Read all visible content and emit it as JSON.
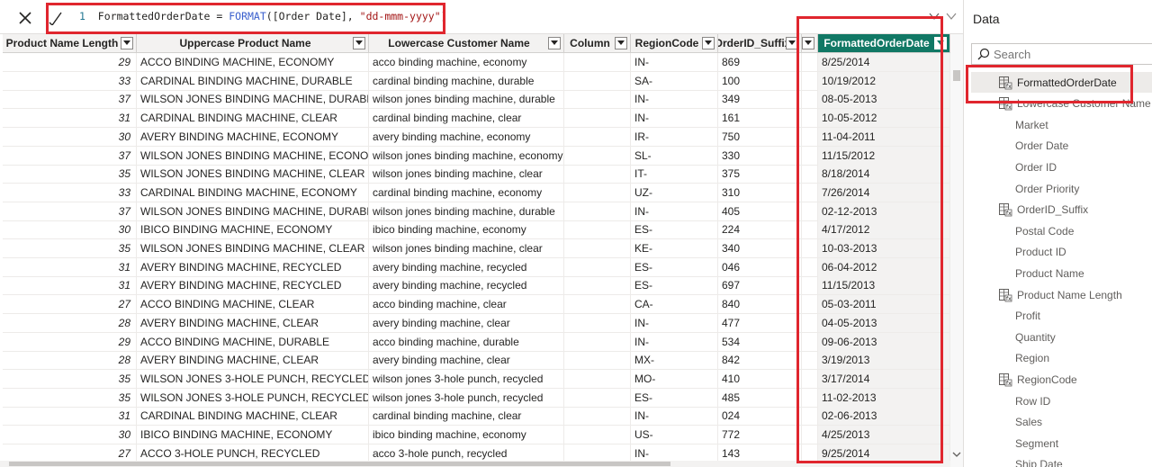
{
  "formula": {
    "line_number": "1",
    "measure_name": "FormattedOrderDate",
    "operator": "=",
    "function": "FORMAT",
    "args_open": "([Order Date], ",
    "format_string": "\"dd-mmm-yyyy\"",
    "args_close": ")"
  },
  "table": {
    "columns": [
      {
        "label": "Product Name Length"
      },
      {
        "label": "Uppercase Product Name"
      },
      {
        "label": "Lowercase Customer Name"
      },
      {
        "label": "Column"
      },
      {
        "label": "RegionCode"
      },
      {
        "label": "OrderID_Suffix"
      },
      {
        "label": ""
      },
      {
        "label": "FormattedOrderDate"
      }
    ],
    "rows": [
      [
        "29",
        "ACCO BINDING MACHINE, ECONOMY",
        "acco binding machine, economy",
        "",
        "IN-",
        "869",
        "",
        "8/25/2014"
      ],
      [
        "33",
        "CARDINAL BINDING MACHINE, DURABLE",
        "cardinal binding machine, durable",
        "",
        "SA-",
        "100",
        "",
        "10/19/2012"
      ],
      [
        "37",
        "WILSON JONES BINDING MACHINE, DURABLE",
        "wilson jones binding machine, durable",
        "",
        "IN-",
        "349",
        "",
        "08-05-2013"
      ],
      [
        "31",
        "CARDINAL BINDING MACHINE, CLEAR",
        "cardinal binding machine, clear",
        "",
        "IN-",
        "161",
        "",
        "10-05-2012"
      ],
      [
        "30",
        "AVERY BINDING MACHINE, ECONOMY",
        "avery binding machine, economy",
        "",
        "IR-",
        "750",
        "",
        "11-04-2011"
      ],
      [
        "37",
        "WILSON JONES BINDING MACHINE, ECONOMY",
        "wilson jones binding machine, economy",
        "",
        "SL-",
        "330",
        "",
        "11/15/2012"
      ],
      [
        "35",
        "WILSON JONES BINDING MACHINE, CLEAR",
        "wilson jones binding machine, clear",
        "",
        "IT-",
        "375",
        "",
        "8/18/2014"
      ],
      [
        "33",
        "CARDINAL BINDING MACHINE, ECONOMY",
        "cardinal binding machine, economy",
        "",
        "UZ-",
        "310",
        "",
        "7/26/2014"
      ],
      [
        "37",
        "WILSON JONES BINDING MACHINE, DURABLE",
        "wilson jones binding machine, durable",
        "",
        "IN-",
        "405",
        "",
        "02-12-2013"
      ],
      [
        "30",
        "IBICO BINDING MACHINE, ECONOMY",
        "ibico binding machine, economy",
        "",
        "ES-",
        "224",
        "",
        "4/17/2012"
      ],
      [
        "35",
        "WILSON JONES BINDING MACHINE, CLEAR",
        "wilson jones binding machine, clear",
        "",
        "KE-",
        "340",
        "",
        "10-03-2013"
      ],
      [
        "31",
        "AVERY BINDING MACHINE, RECYCLED",
        "avery binding machine, recycled",
        "",
        "ES-",
        "046",
        "",
        "06-04-2012"
      ],
      [
        "31",
        "AVERY BINDING MACHINE, RECYCLED",
        "avery binding machine, recycled",
        "",
        "ES-",
        "697",
        "",
        "11/15/2013"
      ],
      [
        "27",
        "ACCO BINDING MACHINE, CLEAR",
        "acco binding machine, clear",
        "",
        "CA-",
        "840",
        "",
        "05-03-2011"
      ],
      [
        "28",
        "AVERY BINDING MACHINE, CLEAR",
        "avery binding machine, clear",
        "",
        "IN-",
        "477",
        "",
        "04-05-2013"
      ],
      [
        "29",
        "ACCO BINDING MACHINE, DURABLE",
        "acco binding machine, durable",
        "",
        "IN-",
        "534",
        "",
        "09-06-2013"
      ],
      [
        "28",
        "AVERY BINDING MACHINE, CLEAR",
        "avery binding machine, clear",
        "",
        "MX-",
        "842",
        "",
        "3/19/2013"
      ],
      [
        "35",
        "WILSON JONES 3-HOLE PUNCH, RECYCLED",
        "wilson jones 3-hole punch, recycled",
        "",
        "MO-",
        "410",
        "",
        "3/17/2014"
      ],
      [
        "35",
        "WILSON JONES 3-HOLE PUNCH, RECYCLED",
        "wilson jones 3-hole punch, recycled",
        "",
        "ES-",
        "485",
        "",
        "11-02-2013"
      ],
      [
        "31",
        "CARDINAL BINDING MACHINE, CLEAR",
        "cardinal binding machine, clear",
        "",
        "IN-",
        "024",
        "",
        "02-06-2013"
      ],
      [
        "30",
        "IBICO BINDING MACHINE, ECONOMY",
        "ibico binding machine, economy",
        "",
        "US-",
        "772",
        "",
        "4/25/2013"
      ],
      [
        "27",
        "ACCO 3-HOLE PUNCH, RECYCLED",
        "acco 3-hole punch, recycled",
        "",
        "IN-",
        "143",
        "",
        "9/25/2014"
      ]
    ]
  },
  "data_pane": {
    "title": "Data",
    "search_placeholder": "Search",
    "fields": [
      {
        "label": "FormattedOrderDate",
        "icon": "calculated-column-icon",
        "selected": true
      },
      {
        "label": "Lowercase Customer Name",
        "icon": "calculated-column-icon",
        "selected": false
      },
      {
        "label": "Market",
        "icon": "",
        "selected": false
      },
      {
        "label": "Order Date",
        "icon": "",
        "selected": false
      },
      {
        "label": "Order ID",
        "icon": "",
        "selected": false
      },
      {
        "label": "Order Priority",
        "icon": "",
        "selected": false
      },
      {
        "label": "OrderID_Suffix",
        "icon": "calculated-column-icon",
        "selected": false
      },
      {
        "label": "Postal Code",
        "icon": "",
        "selected": false
      },
      {
        "label": "Product ID",
        "icon": "",
        "selected": false
      },
      {
        "label": "Product Name",
        "icon": "",
        "selected": false
      },
      {
        "label": "Product Name Length",
        "icon": "calculated-column-icon",
        "selected": false
      },
      {
        "label": "Profit",
        "icon": "",
        "selected": false
      },
      {
        "label": "Quantity",
        "icon": "",
        "selected": false
      },
      {
        "label": "Region",
        "icon": "",
        "selected": false
      },
      {
        "label": "RegionCode",
        "icon": "calculated-column-icon",
        "selected": false
      },
      {
        "label": "Row ID",
        "icon": "",
        "selected": false
      },
      {
        "label": "Sales",
        "icon": "",
        "selected": false
      },
      {
        "label": "Segment",
        "icon": "",
        "selected": false
      },
      {
        "label": "Ship Date",
        "icon": "",
        "selected": false
      }
    ]
  },
  "colors": {
    "active_header": "#117865",
    "highlight": "#e0262e",
    "header_bg": "#f3f2f1"
  }
}
